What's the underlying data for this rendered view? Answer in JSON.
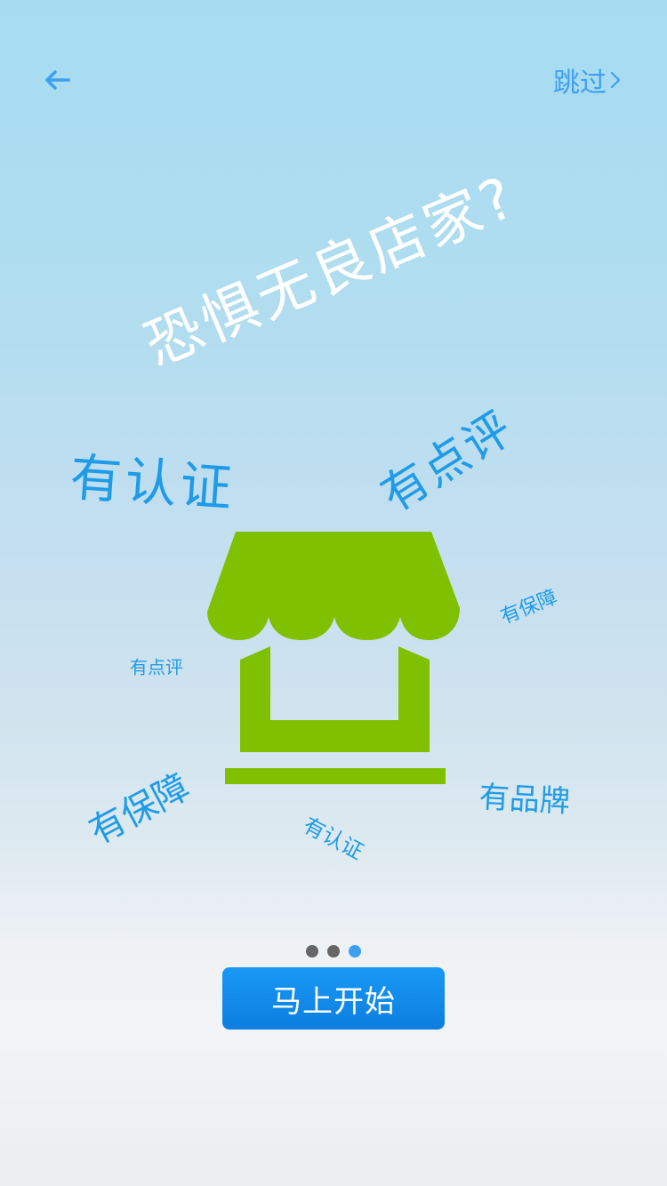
{
  "nav": {
    "back_icon": "arrow-left-icon",
    "skip_label": "跳过",
    "skip_icon": "chevron-right-icon"
  },
  "headline": "恐惧无良店家?",
  "illustration": {
    "icon": "storefront-icon",
    "color": "#7fc000"
  },
  "tags": [
    {
      "label": "有认证"
    },
    {
      "label": "有点评"
    },
    {
      "label": "有保障"
    },
    {
      "label": "有点评"
    },
    {
      "label": "有保障"
    },
    {
      "label": "有认证"
    },
    {
      "label": "有品牌"
    }
  ],
  "pager": {
    "count": 3,
    "active_index": 2,
    "active_color": "#3d9ff2",
    "inactive_color": "#666666"
  },
  "cta": {
    "label": "马上开始"
  },
  "colors": {
    "accent": "#3d9ff2",
    "tag_text": "#1f9be8",
    "button": "#0f88ea"
  }
}
